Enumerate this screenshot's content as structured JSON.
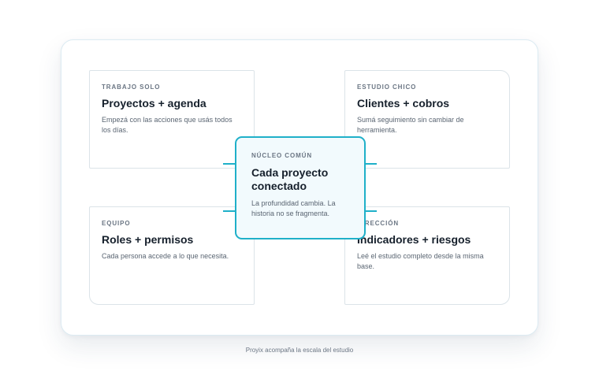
{
  "cards": {
    "top_left": {
      "kicker": "TRABAJO SOLO",
      "title": "Proyectos + agenda",
      "description": "Empezá con las acciones que usás todos los días."
    },
    "top_right": {
      "kicker": "ESTUDIO CHICO",
      "title": "Clientes + cobros",
      "description": "Sumá seguimiento sin cambiar de herramienta."
    },
    "bottom_left": {
      "kicker": "EQUIPO",
      "title": "Roles + permisos",
      "description": "Cada persona accede a lo que necesita."
    },
    "bottom_right": {
      "kicker": "DIRECCIÓN",
      "title": "Indicadores + riesgos",
      "description": "Leé el estudio completo desde la misma base."
    }
  },
  "center": {
    "kicker": "NÚCLEO COMÚN",
    "title": "Cada proyecto conectado",
    "description": "La profundidad cambia. La historia no se fragmenta."
  },
  "caption": "Proyix acompaña la escala del estudio",
  "colors": {
    "accent": "#1fb0c9",
    "center_fill": "#f2fafd",
    "card_border": "#dbe3e8",
    "heading": "#16202c"
  }
}
